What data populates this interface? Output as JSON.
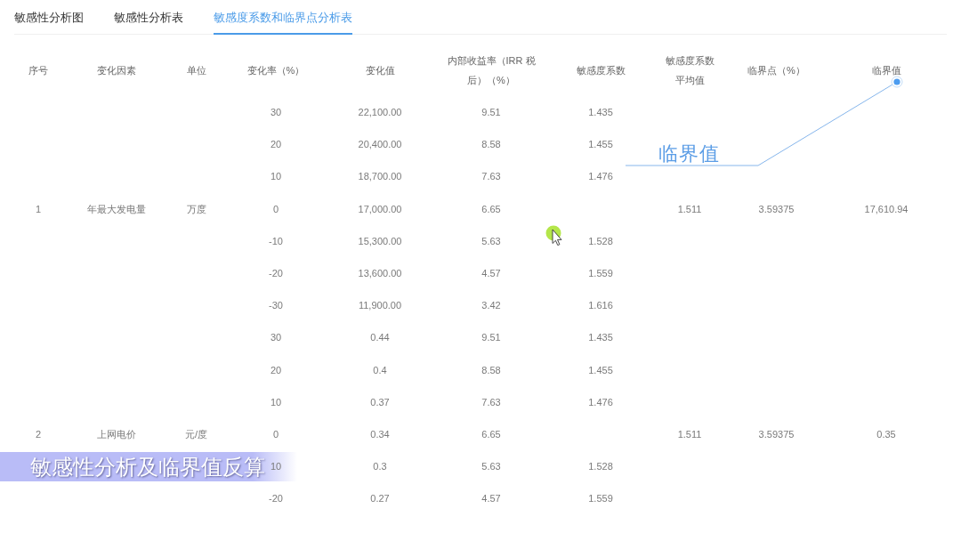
{
  "tabs": [
    {
      "label": "敏感性分析图",
      "selected": false
    },
    {
      "label": "敏感性分析表",
      "selected": false
    },
    {
      "label": "敏感度系数和临界点分析表",
      "selected": true
    }
  ],
  "table": {
    "columns": [
      "序号",
      "变化因素",
      "单位",
      "变化率（%）",
      "变化值",
      "内部收益率（IRR 税后）（%）",
      "敏感度系数",
      "敏感度系数平均值",
      "临界点（%）",
      "临界值"
    ],
    "groups": [
      {
        "no": "1",
        "factor": "年最大发电量",
        "unit": "万度",
        "average": "1.511",
        "critical_point": "3.59375",
        "critical_value": "17,610.94",
        "rows": [
          {
            "change_rate": "30",
            "change_value": "22,100.00",
            "irr": "9.51",
            "sensitivity": "1.435"
          },
          {
            "change_rate": "20",
            "change_value": "20,400.00",
            "irr": "8.58",
            "sensitivity": "1.455"
          },
          {
            "change_rate": "10",
            "change_value": "18,700.00",
            "irr": "7.63",
            "sensitivity": "1.476"
          },
          {
            "change_rate": "0",
            "change_value": "17,000.00",
            "irr": "6.65"
          },
          {
            "change_rate": "-10",
            "change_value": "15,300.00",
            "irr": "5.63",
            "sensitivity": "1.528"
          },
          {
            "change_rate": "-20",
            "change_value": "13,600.00",
            "irr": "4.57",
            "sensitivity": "1.559"
          },
          {
            "change_rate": "-30",
            "change_value": "11,900.00",
            "irr": "3.42",
            "sensitivity": "1.616"
          }
        ]
      },
      {
        "no": "2",
        "factor": "上网电价",
        "unit": "元/度",
        "average": "1.511",
        "critical_point": "3.59375",
        "critical_value": "0.35",
        "rows": [
          {
            "change_rate": "30",
            "change_value": "0.44",
            "irr": "9.51",
            "sensitivity": "1.435"
          },
          {
            "change_rate": "20",
            "change_value": "0.4",
            "irr": "8.58",
            "sensitivity": "1.455"
          },
          {
            "change_rate": "10",
            "change_value": "0.37",
            "irr": "7.63",
            "sensitivity": "1.476"
          },
          {
            "change_rate": "0",
            "change_value": "0.34",
            "irr": "6.65"
          },
          {
            "change_rate": "10",
            "change_value": "0.3",
            "irr": "5.63",
            "sensitivity": "1.528"
          },
          {
            "change_rate": "-20",
            "change_value": "0.27",
            "irr": "4.57",
            "sensitivity": "1.559"
          }
        ]
      }
    ]
  },
  "annotation": {
    "label": "临界值"
  },
  "caption": {
    "text": "敏感性分析及临界值反算"
  }
}
